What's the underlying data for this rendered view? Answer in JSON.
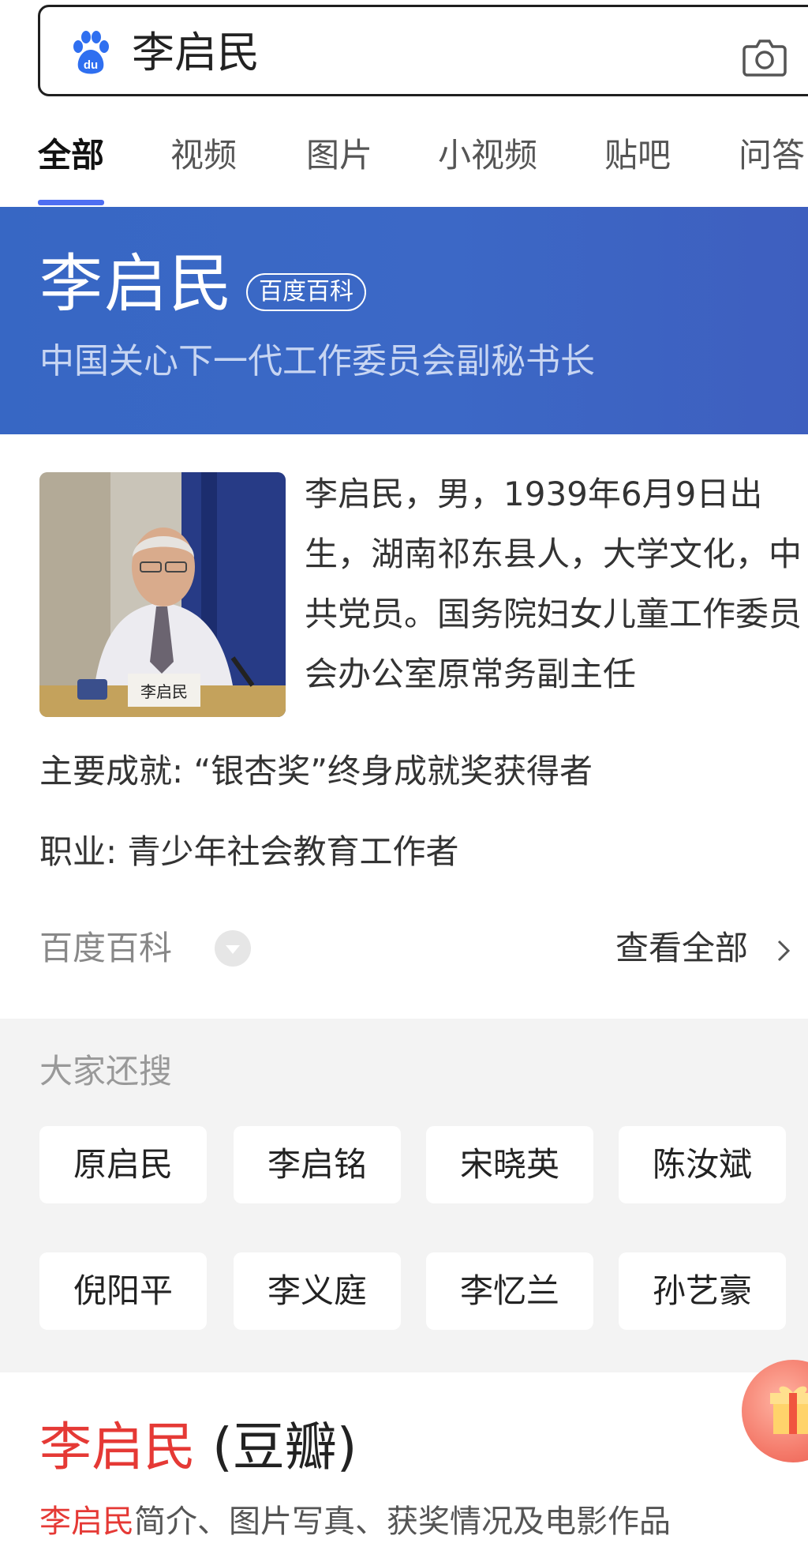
{
  "search": {
    "query": "李启民",
    "logo_icon": "baidu-paw-icon",
    "camera_icon": "camera-icon"
  },
  "tabs": [
    {
      "label": "全部",
      "active": true
    },
    {
      "label": "视频"
    },
    {
      "label": "图片"
    },
    {
      "label": "小视频"
    },
    {
      "label": "贴吧"
    },
    {
      "label": "问答"
    }
  ],
  "hero": {
    "title": "李启民",
    "badge": "百度百科",
    "subtitle": "中国关心下一代工作委员会副秘书长"
  },
  "person": {
    "description": "李启民，男，1939年6月9日出生，湖南祁东县人，大学文化，中共党员。国务院妇女儿童工作委员会办公室原常务副主任",
    "name_plate": "李启民",
    "achievement_label": "主要成就:",
    "achievement_value": "“银杏奖”终身成就奖获得者",
    "occupation_label": "职业:",
    "occupation_value": "青少年社会教育工作者"
  },
  "source": {
    "label": "百度百科",
    "view_all": "查看全部"
  },
  "related": {
    "title": "大家还搜",
    "items": [
      "原启民",
      "李启铭",
      "宋晓英",
      "陈汝斌",
      "倪阳平",
      "李义庭",
      "李忆兰",
      "孙艺豪"
    ]
  },
  "result": {
    "title_highlight": "李启民",
    "title_rest": " (豆瓣)",
    "snippet_highlight": "李启民",
    "snippet_rest": "简介、图片写真、获奖情况及电影作品"
  },
  "colors": {
    "accent": "#4e6ef2",
    "hero_bg": "#3a66c4",
    "highlight_red": "#e53935"
  }
}
